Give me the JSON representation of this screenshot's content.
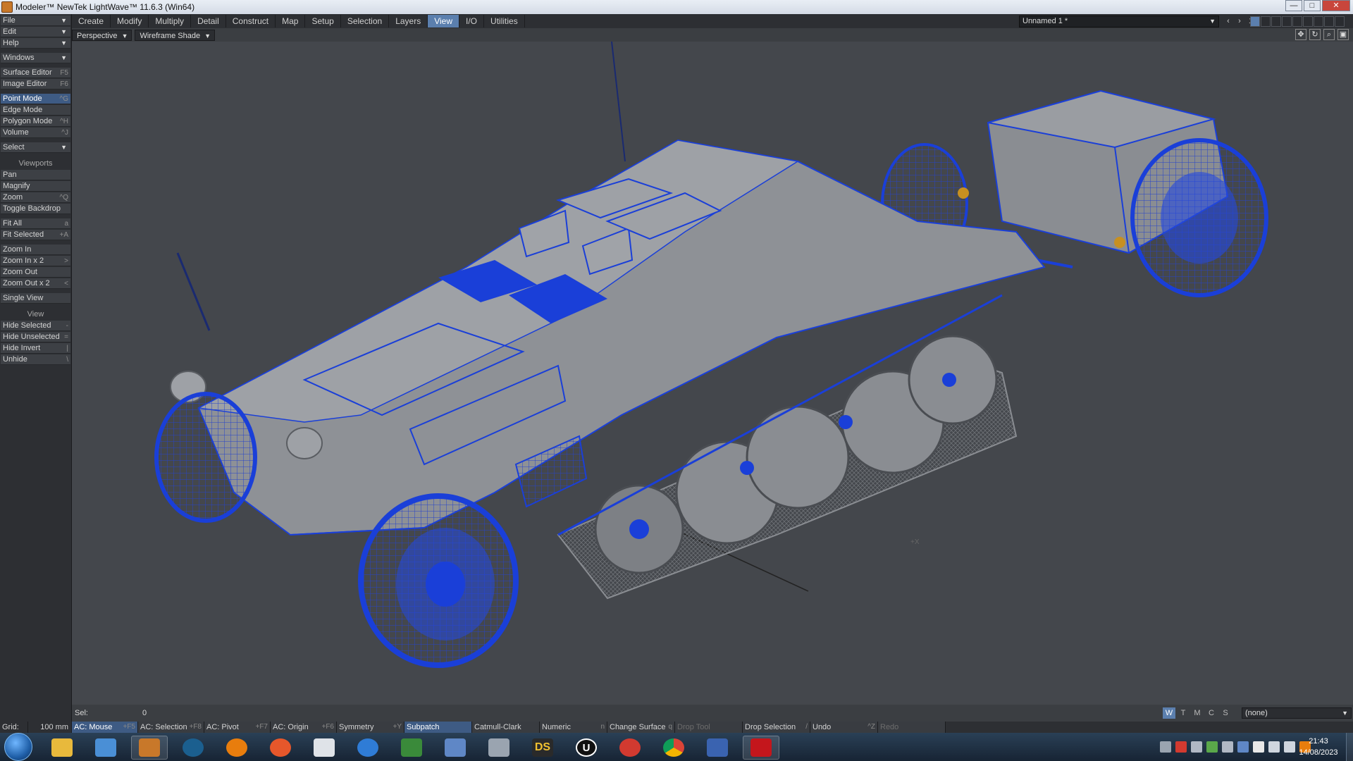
{
  "window": {
    "title": "Modeler™ NewTek LightWave™ 11.6.3 (Win64)",
    "min": "—",
    "max": "□",
    "close": "✕"
  },
  "menu_tabs": [
    "Create",
    "Modify",
    "Multiply",
    "Detail",
    "Construct",
    "Map",
    "Setup",
    "Selection",
    "Layers",
    "View",
    "I/O",
    "Utilities"
  ],
  "active_tab": "View",
  "document": {
    "name": "Unnamed 1 *",
    "layer": "1"
  },
  "viewport": {
    "projection": "Perspective",
    "shading": "Wireframe Shade"
  },
  "toolbar": {
    "file": "File",
    "edit": "Edit",
    "help": "Help",
    "windows": "Windows",
    "surface_editor": "Surface Editor",
    "surface_editor_key": "F5",
    "image_editor": "Image Editor",
    "image_editor_key": "F6",
    "point_mode": "Point Mode",
    "point_mode_key": "^G",
    "edge_mode": "Edge Mode",
    "polygon_mode": "Polygon Mode",
    "polygon_mode_key": "^H",
    "volume": "Volume",
    "volume_key": "^J",
    "select": "Select",
    "viewports_header": "Viewports",
    "pan": "Pan",
    "magnify": "Magnify",
    "zoom": "Zoom",
    "zoom_key": "^Q",
    "toggle_backdrop": "Toggle Backdrop",
    "fit_all": "Fit All",
    "fit_all_key": "a",
    "fit_selected": "Fit Selected",
    "fit_selected_key": "+A",
    "zoom_in": "Zoom In",
    "zoom_in_x2": "Zoom In x 2",
    "zoom_in_x2_key": ">",
    "zoom_out": "Zoom Out",
    "zoom_out_x2": "Zoom Out x 2",
    "zoom_out_x2_key": "<",
    "single_view": "Single View",
    "view_header": "View",
    "hide_selected": "Hide Selected",
    "hide_selected_key": "-",
    "hide_unselected": "Hide Unselected",
    "hide_unselected_key": "=",
    "hide_invert": "Hide Invert",
    "hide_invert_key": "|",
    "unhide": "Unhide",
    "unhide_key": "\\"
  },
  "status": {
    "sel_label": "Sel:",
    "sel_value": "0",
    "view_modes": [
      "W",
      "T",
      "M",
      "C",
      "S"
    ],
    "active_view_mode": "W",
    "surface": "(none)"
  },
  "bottom_bar": {
    "grid_label": "Grid:",
    "grid_value": "100 mm",
    "ac_mouse": "AC: Mouse",
    "ac_mouse_key": "+F5",
    "ac_selection": "AC: Selection",
    "ac_selection_key": "+F8",
    "ac_pivot": "AC: Pivot",
    "ac_pivot_key": "+F7",
    "ac_origin": "AC: Origin",
    "ac_origin_key": "+F6",
    "symmetry": "Symmetry",
    "symmetry_key": "+Y",
    "subpatch": "Subpatch",
    "catmull_clark": "Catmull-Clark",
    "numeric": "Numeric",
    "numeric_key": "n",
    "change_surface": "Change Surface",
    "change_surface_key": "q",
    "drop_tool": "Drop Tool",
    "drop_selection": "Drop Selection",
    "drop_selection_key": "/",
    "undo": "Undo",
    "undo_key": "^Z",
    "redo": "Redo"
  },
  "taskbar": {
    "apps": [
      "windows-explorer",
      "screenshot-tool",
      "lightwave-modeler",
      "steam",
      "blender",
      "firefox",
      "notes",
      "thunderbird",
      "spreadsheet",
      "email",
      "calculator",
      "daz-studio",
      "unity",
      "capture-one",
      "chrome",
      "zbrush",
      "acrobat-reader"
    ],
    "ds_label": "DS",
    "u_label": "U",
    "time": "21:43",
    "date": "14/08/2023"
  },
  "colors": {
    "accent": "#5b7fae",
    "wire": "#1a3fd8",
    "hull": "#8e9196",
    "viewport_bg": "#44474c"
  }
}
